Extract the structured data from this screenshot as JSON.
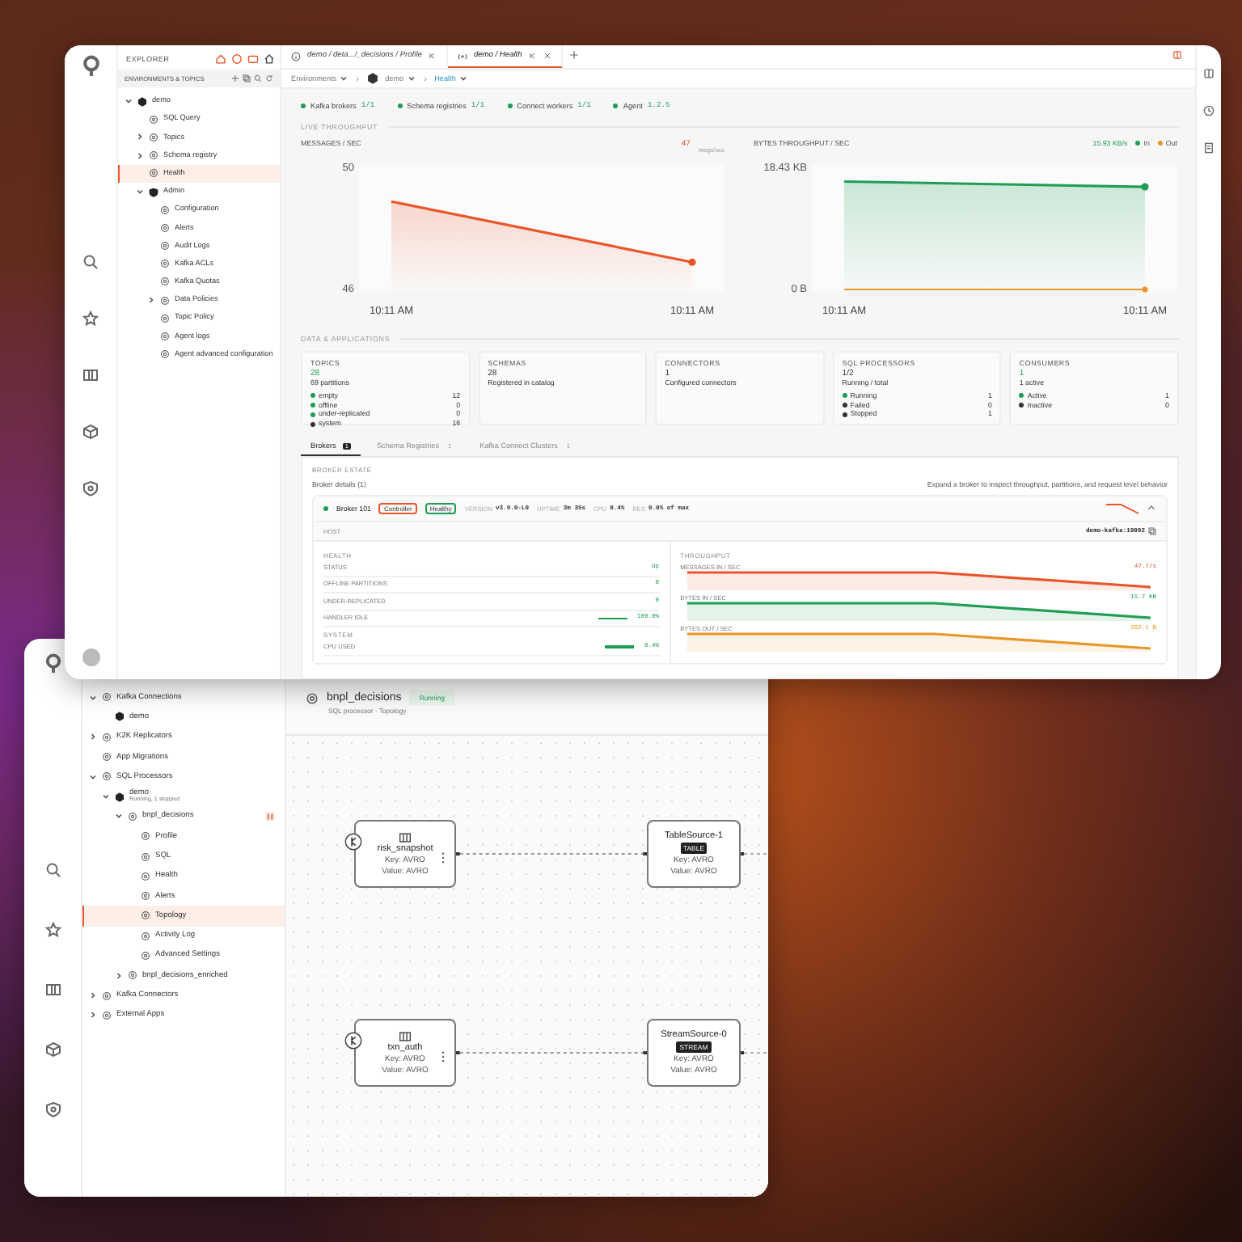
{
  "front_window": {
    "sidebar": {
      "title": "EXPLORER",
      "section": "ENVIRONMENTS & TOPICS",
      "tree": [
        {
          "label": "demo",
          "kind": "environment",
          "selected": false,
          "expanded": true,
          "children": [
            {
              "label": "SQL Query",
              "kind": "page",
              "selected": false
            },
            {
              "label": "Topics",
              "kind": "page",
              "selected": false,
              "expanded": false
            },
            {
              "label": "Schema registry",
              "kind": "page",
              "selected": false,
              "expanded": false
            },
            {
              "label": "Health",
              "kind": "page",
              "selected": true
            },
            {
              "label": "Admin",
              "kind": "shield",
              "selected": false,
              "expanded": true,
              "children": [
                {
                  "label": "Configuration",
                  "kind": "page",
                  "selected": false
                },
                {
                  "label": "Alerts",
                  "kind": "page",
                  "selected": false
                },
                {
                  "label": "Audit Logs",
                  "kind": "page",
                  "selected": false
                },
                {
                  "label": "Kafka ACLs",
                  "kind": "page",
                  "selected": false
                },
                {
                  "label": "Kafka Quotas",
                  "kind": "page",
                  "selected": false
                },
                {
                  "label": "Data Policies",
                  "kind": "page",
                  "selected": false,
                  "expanded": false
                },
                {
                  "label": "Topic Policy",
                  "kind": "page",
                  "selected": false
                },
                {
                  "label": "Agent logs",
                  "kind": "page",
                  "selected": false
                },
                {
                  "label": "Agent advanced configuration",
                  "kind": "page",
                  "selected": false
                }
              ]
            }
          ]
        }
      ]
    },
    "tabs": [
      {
        "label": "demo / deta.../_decisions / Profile",
        "kind": "info",
        "selected": false
      },
      {
        "label": "demo / Health",
        "kind": "health",
        "selected": true
      }
    ],
    "breadcrumb": [
      {
        "label": "Environments",
        "selected": false
      },
      {
        "label": "demo",
        "selected": false
      },
      {
        "label": "Health",
        "selected": true
      }
    ],
    "status": [
      {
        "label": "Kafka brokers",
        "value": "1/1"
      },
      {
        "label": "Schema registries",
        "value": "1/1"
      },
      {
        "label": "Connect workers",
        "value": "1/1"
      },
      {
        "label": "Agent",
        "value": "1.2.5"
      }
    ],
    "throughput": {
      "title": "LIVE THROUGHPUT",
      "charts": [
        {
          "title": "MESSAGES / SEC",
          "reading": "47",
          "note": "msgs/sec",
          "chart_data": {
            "type": "area",
            "x": [
              "10:11 AM",
              "10:11 AM"
            ],
            "series": [
              {
                "color": "#e8562a",
                "values": [
                  48.9,
                  46.9
                ]
              }
            ],
            "ylim": [
              46,
              50
            ],
            "yticks": [
              46,
              50
            ]
          }
        },
        {
          "title": "BYTES THROUGHPUT / SEC",
          "reading": "15.93 KB/s",
          "chart_data": {
            "type": "area",
            "legend": "top-right",
            "x": [
              "10:11 AM",
              "10:11 AM"
            ],
            "series": [
              {
                "name": "In",
                "color": "#1f9d55",
                "values": [
                  16.4,
                  15.6
                ]
              },
              {
                "name": "Out",
                "color": "#e8962a",
                "type": "line",
                "values": [
                  0,
                  0
                ]
              }
            ],
            "ylim": [
              0,
              18.43
            ],
            "yticks": [
              {
                "value": 0,
                "label": "0 B"
              },
              {
                "value": 18.43,
                "label": "18.43 KB"
              }
            ]
          }
        }
      ]
    },
    "data_apps": {
      "title": "DATA & APPLICATIONS",
      "cards": [
        {
          "title": "TOPICS",
          "value": "28",
          "highlight": true,
          "subtitle": "69 partitions",
          "rows": [
            {
              "label": "empty",
              "value": "12",
              "color": "#1f9d55"
            },
            {
              "label": "offline",
              "value": "0",
              "color": "#1f9d55"
            },
            {
              "label": "under-replicated",
              "value": "0",
              "color": "#1f9d55"
            },
            {
              "label": "system",
              "value": "16",
              "color": "#333333"
            }
          ]
        },
        {
          "title": "SCHEMAS",
          "value": "28",
          "highlight": false,
          "subtitle": "Registered in catalog"
        },
        {
          "title": "CONNECTORS",
          "value": "1",
          "highlight": false,
          "subtitle": "Configured connectors"
        },
        {
          "title": "SQL PROCESSORS",
          "value": "1/2",
          "highlight": false,
          "subtitle": "Running / total",
          "rows": [
            {
              "label": "Running",
              "value": "1",
              "color": "#1f9d55"
            },
            {
              "label": "Failed",
              "value": "0",
              "color": "#333333"
            },
            {
              "label": "Stopped",
              "value": "1",
              "color": "#333333"
            }
          ]
        },
        {
          "title": "CONSUMERS",
          "value": "1",
          "highlight": true,
          "subtitle": "1 active",
          "rows": [
            {
              "label": "Active",
              "value": "1",
              "color": "#1f9d55"
            },
            {
              "label": "Inactive",
              "value": "0",
              "color": "#333333"
            }
          ]
        }
      ]
    },
    "content_tabs": [
      {
        "label": "Brokers",
        "count": "1",
        "selected": true
      },
      {
        "label": "Schema Registries",
        "count": "1",
        "selected": false
      },
      {
        "label": "Kafka Connect Clusters",
        "count": "1",
        "selected": false
      }
    ],
    "brokers": {
      "section": "BROKER ESTATE",
      "title": "Broker details (1)",
      "hint": "Expand a broker to inspect throughput, partitions, and request level behavior",
      "broker": {
        "name": "Broker 101",
        "expanded": true,
        "tags": [
          {
            "label": "Controller",
            "color": "#e8562a"
          },
          {
            "label": "Healthy",
            "color": "#1f9d55"
          }
        ],
        "stats": [
          {
            "label": "VERSION",
            "value": "v3.9.0-L0"
          },
          {
            "label": "UPTIME",
            "value": "3m 35s"
          },
          {
            "label": "CPU",
            "value": "0.4%"
          },
          {
            "label": "RES",
            "value": "0.0% of max"
          }
        ],
        "host_label": "HOST",
        "host": "demo-kafka:19092",
        "health": {
          "title": "HEALTH",
          "rows": [
            {
              "label": "STATUS",
              "value": "Up"
            },
            {
              "label": "OFFLINE PARTITIONS",
              "value": "0"
            },
            {
              "label": "UNDER-REPLICATED",
              "value": "0"
            },
            {
              "label": "HANDLER IDLE",
              "value": "100.0%",
              "level": 1
            }
          ]
        },
        "system": {
          "title": "SYSTEM",
          "rows": [
            {
              "label": "CPU USED",
              "value": "0.4%",
              "level": 1
            }
          ]
        },
        "throughput": {
          "title": "THROUGHPUT",
          "rows": [
            {
              "label": "MESSAGES IN / SEC",
              "value": "47.7/s",
              "color": "#e8562a"
            },
            {
              "label": "BYTES IN / SEC",
              "value": "15.7 KB",
              "color": "#1f9d55"
            },
            {
              "label": "BYTES OUT / SEC",
              "value": "282.1 B",
              "color": "#e8962a"
            }
          ]
        }
      }
    }
  },
  "back_window": {
    "tree": [
      {
        "label": "Kafka Connections",
        "kind": "page",
        "selected": false,
        "expanded": true,
        "children": [
          {
            "label": "demo",
            "kind": "environment",
            "selected": false
          }
        ]
      },
      {
        "label": "K2K Replicators",
        "kind": "page",
        "selected": false,
        "expanded": false
      },
      {
        "label": "App Migrations",
        "kind": "page",
        "selected": false
      },
      {
        "label": "SQL Processors",
        "kind": "page",
        "selected": false,
        "expanded": true,
        "children": [
          {
            "label": "demo",
            "note": "Running, 1 stopped",
            "kind": "environment",
            "selected": false,
            "expanded": true,
            "children": [
              {
                "label": "bnpl_decisions",
                "kind": "page",
                "selected": false,
                "expanded": true,
                "paused": true,
                "children": [
                  {
                    "label": "Profile",
                    "kind": "page",
                    "selected": false
                  },
                  {
                    "label": "SQL",
                    "kind": "page",
                    "selected": false
                  },
                  {
                    "label": "Health",
                    "kind": "page",
                    "selected": false
                  },
                  {
                    "label": "Alerts",
                    "kind": "page",
                    "selected": false
                  },
                  {
                    "label": "Topology",
                    "kind": "page",
                    "selected": true
                  },
                  {
                    "label": "Activity Log",
                    "kind": "page",
                    "selected": false
                  },
                  {
                    "label": "Advanced Settings",
                    "kind": "page",
                    "selected": false
                  }
                ]
              },
              {
                "label": "bnpl_decisions_enriched",
                "kind": "page",
                "selected": false,
                "expanded": false
              }
            ]
          }
        ]
      },
      {
        "label": "Kafka Connectors",
        "kind": "page",
        "selected": false,
        "expanded": false
      },
      {
        "label": "External Apps",
        "kind": "page",
        "selected": false,
        "expanded": false
      }
    ],
    "header": {
      "title": "bnpl_decisions",
      "status": "Running",
      "subtitle": "SQL processor · Topology"
    },
    "topology": [
      {
        "source": {
          "name": "risk_snapshot",
          "key": "Key: AVRO",
          "value": "Value: AVRO"
        },
        "target": {
          "name": "TableSource-1",
          "badge": "TABLE",
          "key": "Key: AVRO",
          "value": "Value: AVRO"
        }
      },
      {
        "source": {
          "name": "txn_auth",
          "key": "Key: AVRO",
          "value": "Value: AVRO"
        },
        "target": {
          "name": "StreamSource-0",
          "badge": "STREAM",
          "key": "Key: AVRO",
          "value": "Value: AVRO"
        }
      }
    ]
  }
}
